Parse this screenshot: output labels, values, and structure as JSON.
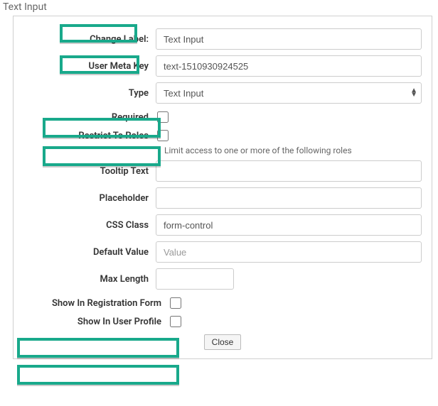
{
  "panel": {
    "title": "Text Input"
  },
  "fields": {
    "change_label": {
      "label": "Change Label:",
      "value": "Text Input"
    },
    "user_meta_key": {
      "label": "User Meta Key",
      "value": "text-1510930924525"
    },
    "type": {
      "label": "Type",
      "value": "Text Input"
    },
    "required": {
      "label": "Required"
    },
    "restrict_roles": {
      "label": "Restrict To Roles",
      "helper": "Limit access to one or more of the following roles"
    },
    "tooltip_text": {
      "label": "Tooltip Text",
      "value": ""
    },
    "placeholder": {
      "label": "Placeholder",
      "value": ""
    },
    "css_class": {
      "label": "CSS Class",
      "value": "form-control"
    },
    "default_value": {
      "label": "Default Value",
      "placeholder": "Value",
      "value": ""
    },
    "max_length": {
      "label": "Max Length",
      "value": ""
    },
    "show_registration": {
      "label": "Show In Registration Form"
    },
    "show_profile": {
      "label": "Show In User Profile"
    }
  },
  "footer": {
    "close": "Close"
  }
}
